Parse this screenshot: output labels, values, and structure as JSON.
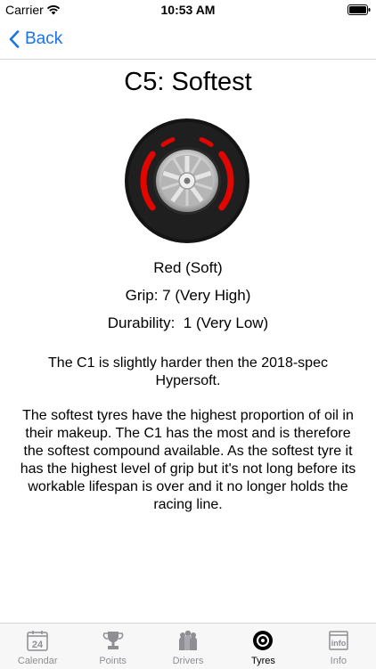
{
  "status": {
    "carrier": "Carrier",
    "time": "10:53 AM"
  },
  "nav": {
    "back_label": "Back"
  },
  "tyre": {
    "title": "C5: Softest",
    "colour_name": "Red (Soft)",
    "grip": "Grip: 7 (Very High)",
    "durability": "Durability:  1 (Very Low)",
    "band_color": "#e10600",
    "description_1": "The C1 is slightly harder then the 2018-spec Hypersoft.",
    "description_2": "The softest tyres have the highest proportion of oil in their makeup.  The C1 has the most and is therefore the softest compound available.  As the softest tyre it has the highest level of grip but it's not long before its workable lifespan is over and it no longer holds the racing line."
  },
  "tabs": [
    {
      "label": "Calendar",
      "icon": "calendar-icon",
      "badge": "24"
    },
    {
      "label": "Points",
      "icon": "trophy-icon"
    },
    {
      "label": "Drivers",
      "icon": "drivers-icon"
    },
    {
      "label": "Tyres",
      "icon": "tyre-icon"
    },
    {
      "label": "Info",
      "icon": "info-icon",
      "badge": "info"
    }
  ],
  "colors": {
    "accent": "#1a73e8",
    "active_tab": "#000000",
    "inactive_tab": "#8e8e93"
  }
}
